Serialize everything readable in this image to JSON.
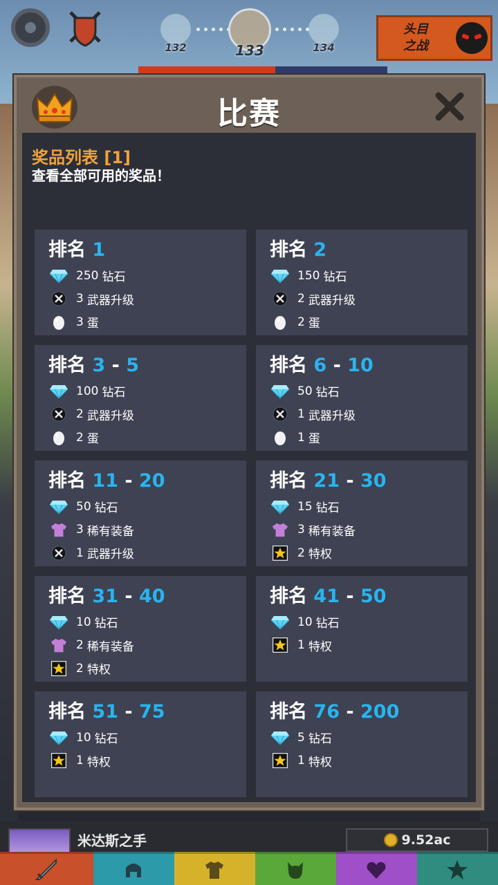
{
  "hud": {
    "stages": [
      "132",
      "133",
      "134"
    ],
    "boss_button": {
      "line1": "头目",
      "line2": "之战"
    }
  },
  "modal": {
    "title": "比赛",
    "prize_list_title": "奖品列表 [1]",
    "prize_list_subtitle": "查看全部可用的奖品！"
  },
  "rank_label": "排名",
  "tiers": [
    {
      "from": "1",
      "to": "",
      "rewards": [
        {
          "icon": "diamond-icon",
          "amount": "250",
          "label": "钻石"
        },
        {
          "icon": "weapon-upgrade-icon",
          "amount": "3",
          "label": "武器升级"
        },
        {
          "icon": "egg-icon",
          "amount": "3",
          "label": "蛋"
        }
      ]
    },
    {
      "from": "2",
      "to": "",
      "rewards": [
        {
          "icon": "diamond-icon",
          "amount": "150",
          "label": "钻石"
        },
        {
          "icon": "weapon-upgrade-icon",
          "amount": "2",
          "label": "武器升级"
        },
        {
          "icon": "egg-icon",
          "amount": "2",
          "label": "蛋"
        }
      ]
    },
    {
      "from": "3",
      "to": "5",
      "rewards": [
        {
          "icon": "diamond-icon",
          "amount": "100",
          "label": "钻石"
        },
        {
          "icon": "weapon-upgrade-icon",
          "amount": "2",
          "label": "武器升级"
        },
        {
          "icon": "egg-icon",
          "amount": "2",
          "label": "蛋"
        }
      ]
    },
    {
      "from": "6",
      "to": "10",
      "rewards": [
        {
          "icon": "diamond-icon",
          "amount": "50",
          "label": "钻石"
        },
        {
          "icon": "weapon-upgrade-icon",
          "amount": "1",
          "label": "武器升级"
        },
        {
          "icon": "egg-icon",
          "amount": "1",
          "label": "蛋"
        }
      ]
    },
    {
      "from": "11",
      "to": "20",
      "rewards": [
        {
          "icon": "diamond-icon",
          "amount": "50",
          "label": "钻石"
        },
        {
          "icon": "rare-gear-icon",
          "amount": "3",
          "label": "稀有装备"
        },
        {
          "icon": "weapon-upgrade-icon",
          "amount": "1",
          "label": "武器升级"
        }
      ]
    },
    {
      "from": "21",
      "to": "30",
      "rewards": [
        {
          "icon": "diamond-icon",
          "amount": "15",
          "label": "钻石"
        },
        {
          "icon": "rare-gear-icon",
          "amount": "3",
          "label": "稀有装备"
        },
        {
          "icon": "privilege-star-icon",
          "amount": "2",
          "label": "特权"
        }
      ]
    },
    {
      "from": "31",
      "to": "40",
      "rewards": [
        {
          "icon": "diamond-icon",
          "amount": "10",
          "label": "钻石"
        },
        {
          "icon": "rare-gear-icon",
          "amount": "2",
          "label": "稀有装备"
        },
        {
          "icon": "privilege-star-icon",
          "amount": "2",
          "label": "特权"
        }
      ]
    },
    {
      "from": "41",
      "to": "50",
      "rewards": [
        {
          "icon": "diamond-icon",
          "amount": "10",
          "label": "钻石"
        },
        {
          "icon": "privilege-star-icon",
          "amount": "1",
          "label": "特权"
        }
      ]
    },
    {
      "from": "51",
      "to": "75",
      "rewards": [
        {
          "icon": "diamond-icon",
          "amount": "10",
          "label": "钻石"
        },
        {
          "icon": "privilege-star-icon",
          "amount": "1",
          "label": "特权"
        }
      ]
    },
    {
      "from": "76",
      "to": "200",
      "rewards": [
        {
          "icon": "diamond-icon",
          "amount": "5",
          "label": "钻石"
        },
        {
          "icon": "privilege-star-icon",
          "amount": "1",
          "label": "特权"
        }
      ]
    }
  ],
  "bottom": {
    "hero_name": "米达斯之手",
    "gold": "9.52ac",
    "tabs": [
      "sword-icon",
      "helmet-icon",
      "shirt-icon",
      "pet-icon",
      "heart-icon",
      "star-icon"
    ]
  },
  "colors": {
    "rank_number": "#28b4f0",
    "prize_title": "#f1a23a",
    "card_bg": "#3e4252",
    "panel_bg": "#2c2f38"
  }
}
